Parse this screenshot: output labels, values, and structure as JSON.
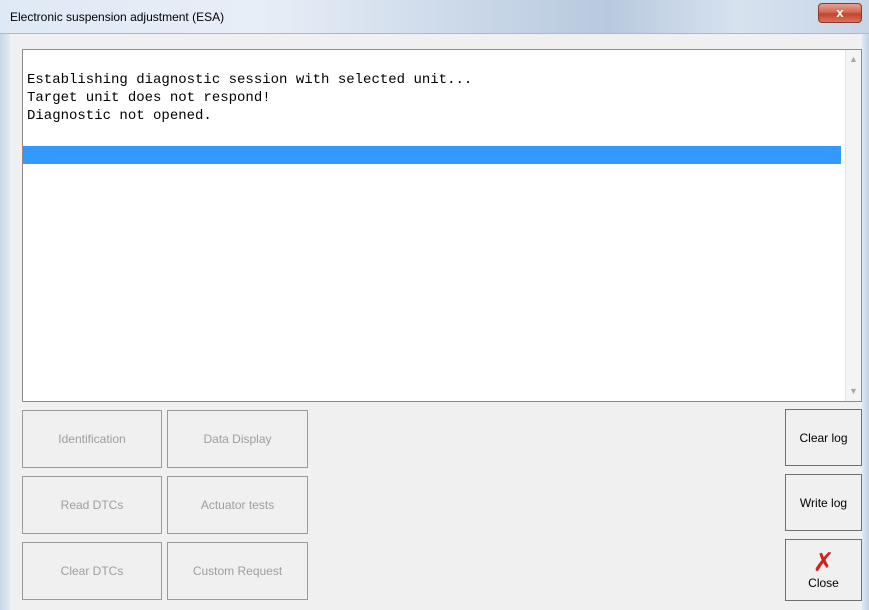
{
  "window": {
    "title": "Electronic suspension adjustment (ESA)",
    "close_glyph": "x"
  },
  "log": {
    "lines": [
      "Establishing diagnostic session with selected unit...",
      "Target unit does not respond!",
      "Diagnostic not opened."
    ],
    "scroll_up_icon": "arrow-up",
    "scroll_down_icon": "arrow-down"
  },
  "buttons": {
    "identification": "Identification",
    "data_display": "Data Display",
    "read_dtcs": "Read DTCs",
    "actuator_tests": "Actuator tests",
    "clear_dtcs": "Clear DTCs",
    "custom_request": "Custom Request",
    "clear_log": "Clear log",
    "write_log": "Write log",
    "close": "Close"
  },
  "colors": {
    "selection": "#3399ff",
    "close_icon": "#d62020",
    "disabled_text": "#9e9e9e"
  }
}
